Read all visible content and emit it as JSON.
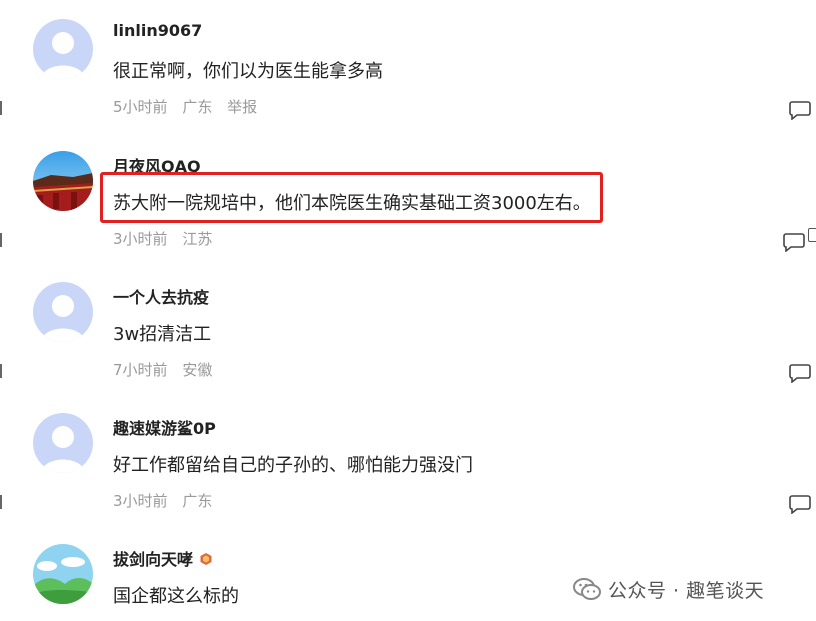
{
  "comments": [
    {
      "username": "linlin9067",
      "text": "很正常啊，你们以为医生能拿多高",
      "time": "5小时前",
      "location": "广东",
      "report": "举报",
      "avatar": "default-avatar-icon"
    },
    {
      "username": "月夜风QAQ",
      "text": "苏大附一院规培中，他们本院医生确实基础工资3000左右。",
      "time": "3小时前",
      "location": "江苏",
      "avatar": "palace-photo-avatar"
    },
    {
      "username": "一个人去抗疫",
      "text": "3w招清洁工",
      "time": "7小时前",
      "location": "安徽",
      "avatar": "default-avatar-icon"
    },
    {
      "username": "趣速媒游鲨0P",
      "text": "好工作都留给自己的子孙的、哪怕能力强没门",
      "time": "3小时前",
      "location": "广东",
      "avatar": "default-avatar-icon"
    },
    {
      "username": "拔剑向天哮",
      "text": "国企都这么标的",
      "avatar": "landscape-avatar"
    }
  ],
  "highlight_color": "#e0211f",
  "watermark": {
    "text": "公众号 · 趣笔谈天",
    "icon": "wechat-icon"
  }
}
